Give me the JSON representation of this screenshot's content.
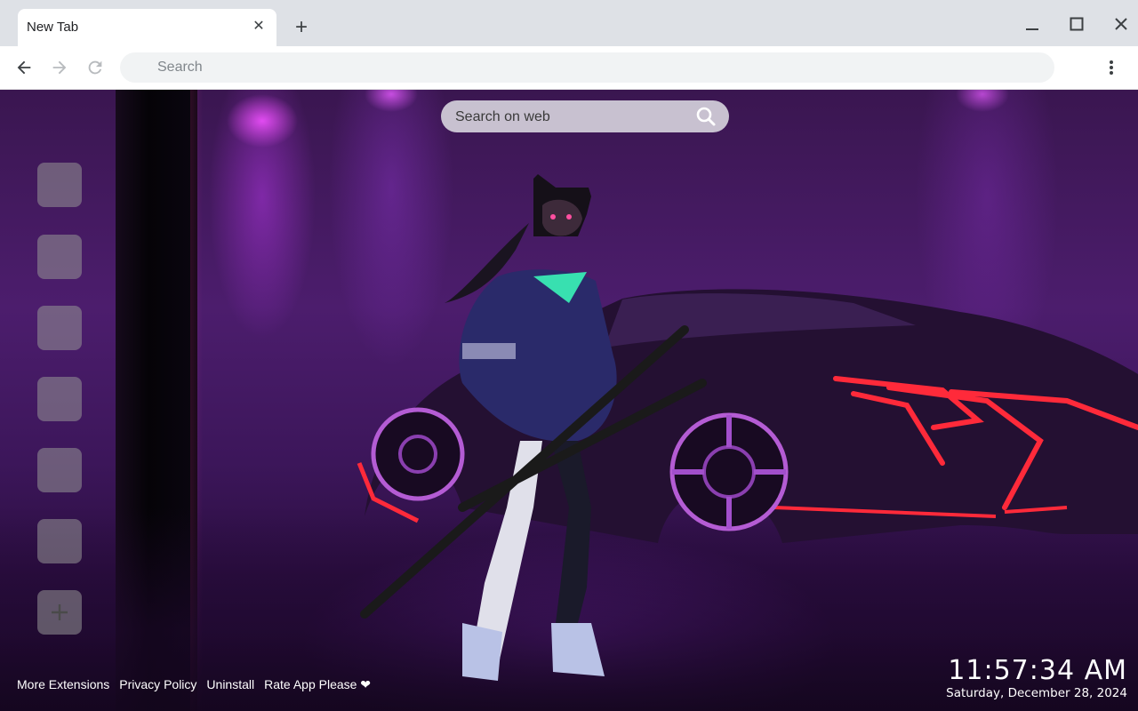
{
  "browser": {
    "tab": {
      "title": "New Tab"
    },
    "toolbar": {
      "omnibox_placeholder": "Search"
    }
  },
  "newtab": {
    "web_search": {
      "placeholder": "Search on web"
    },
    "shortcut_count": 6,
    "footer_links": [
      {
        "label": "More Extensions"
      },
      {
        "label": "Privacy Policy"
      },
      {
        "label": "Uninstall"
      },
      {
        "label": "Rate App Please ❤"
      }
    ],
    "clock": {
      "time": "11:57:34 AM",
      "date": "Saturday, December 28, 2024"
    },
    "background_description_colors": {
      "primary": "#4c1d6d",
      "neon_red": "#ff2a3a",
      "neon_magenta": "#e84bff"
    }
  },
  "icons": {
    "tab_close": "close-icon",
    "new_tab": "plus-icon",
    "minimize": "minimize-icon",
    "maximize": "maximize-icon",
    "close_window": "close-icon",
    "back": "arrow-left-icon",
    "forward": "arrow-right-icon",
    "reload": "reload-icon",
    "menu": "kebab-menu-icon",
    "search": "search-icon",
    "add_shortcut": "plus-icon"
  }
}
